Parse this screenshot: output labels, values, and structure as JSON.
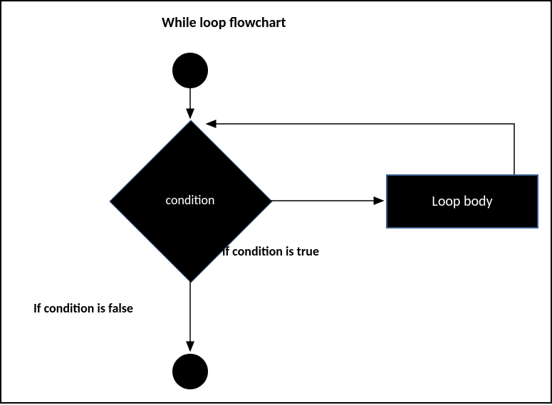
{
  "title": "While loop flowchart",
  "nodes": {
    "condition": "condition",
    "loop_body": "Loop body"
  },
  "edges": {
    "true_label": "if condition is true",
    "false_label": "If condition is false"
  },
  "chart_data": {
    "type": "flowchart",
    "title": "While loop flowchart",
    "nodes": [
      {
        "id": "start",
        "shape": "circle",
        "label": ""
      },
      {
        "id": "condition",
        "shape": "decision",
        "label": "condition"
      },
      {
        "id": "loop_body",
        "shape": "process",
        "label": "Loop body"
      },
      {
        "id": "end",
        "shape": "circle",
        "label": ""
      }
    ],
    "edges": [
      {
        "from": "start",
        "to": "condition",
        "label": ""
      },
      {
        "from": "condition",
        "to": "loop_body",
        "label": "if condition is true"
      },
      {
        "from": "loop_body",
        "to": "condition",
        "label": ""
      },
      {
        "from": "condition",
        "to": "end",
        "label": "If condition is false"
      }
    ]
  }
}
